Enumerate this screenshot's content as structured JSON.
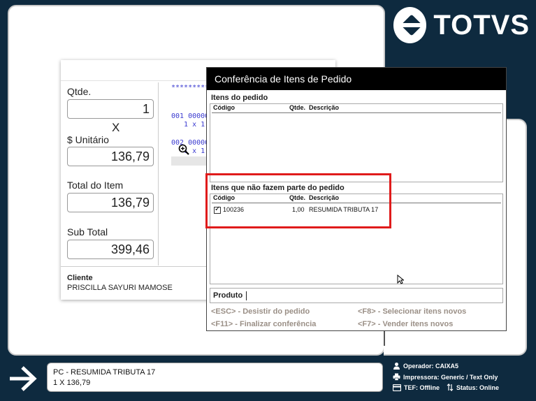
{
  "logo": {
    "text": "TOTVS"
  },
  "sale": {
    "qtde_label": "Qtde.",
    "qtde_value": "1",
    "times": "X",
    "unit_label": "$ Unitário",
    "unit_value": "136,79",
    "total_label": "Total do Item",
    "total_value": "136,79",
    "subtotal_label": "Sub Total",
    "subtotal_value": "399,46",
    "client_label": "Cliente",
    "client_name": "PRISCILLA SAYURI MAMOSE",
    "receipt": {
      "stars": "**********",
      "line1": "001 00000",
      "line2": "   1 x 1",
      "line3": "002 00000",
      "line4": "   1 x 1"
    }
  },
  "dialog": {
    "title": "Conferência de Itens de Pedido",
    "section1_label": "Itens do pedido",
    "section2_label": "Itens que não fazem parte do pedido",
    "columns": {
      "code": "Código",
      "qty": "Qtde.",
      "desc": "Descrição"
    },
    "order_items": [],
    "extra_items": [
      {
        "checked": true,
        "code": "100236",
        "qty": "1,00",
        "desc": "RESUMIDA TRIBUTA 17"
      }
    ],
    "produto_label": "Produto",
    "shortcuts": {
      "esc": "<ESC> - Desistir do pedido",
      "f8": "<F8> - Selecionar itens novos",
      "f11": "<F11> - Finalizar conferência",
      "f7": "<F7> - Vender itens novos"
    }
  },
  "bottom": {
    "msg_line1": "PC - RESUMIDA TRIBUTA 17",
    "msg_line2": "1 X 136,79",
    "operator": "Operador: CAIXA5",
    "printer": "Impressora: Generic / Text Only",
    "tef": "TEF: Offline",
    "status": "Status: Online"
  }
}
